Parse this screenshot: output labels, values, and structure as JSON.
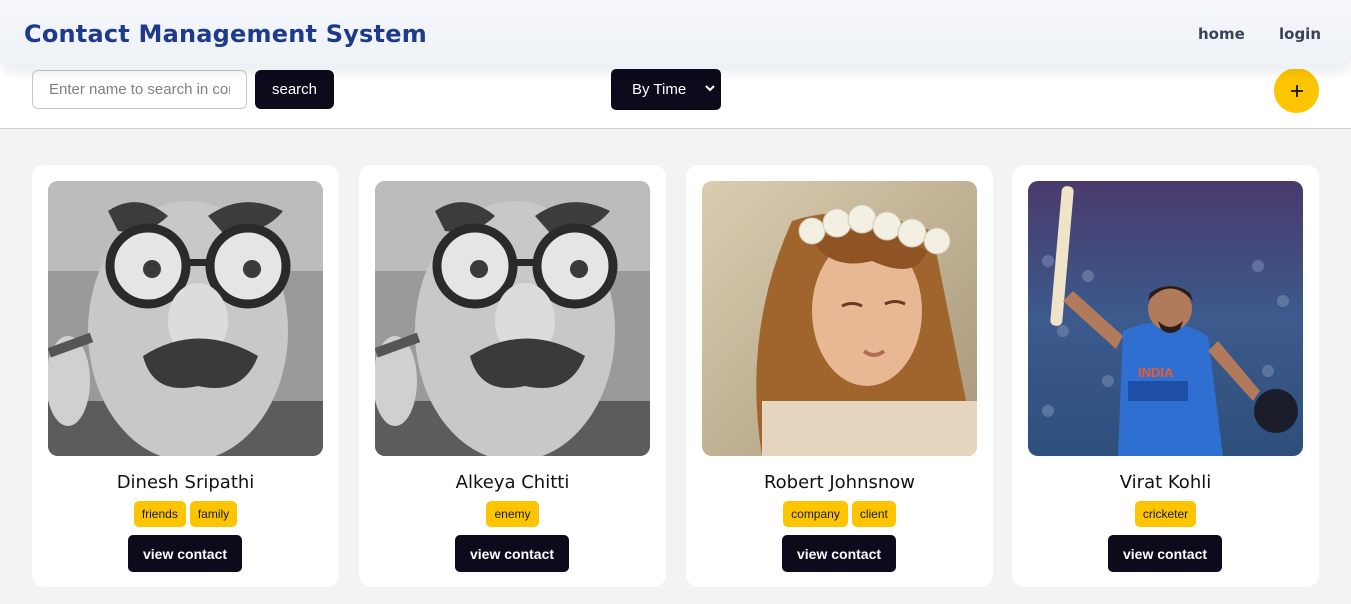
{
  "navbar": {
    "brand": "Contact Management System",
    "links": [
      "home",
      "login"
    ]
  },
  "toolbar": {
    "search_placeholder": "Enter name to search in contacts",
    "search_label": "search",
    "sort_value": "By Time",
    "add_icon": "plus-icon"
  },
  "colors": {
    "brand": "#1e3a8a",
    "accent": "#fcc500",
    "dark_button": "#0d0a1c",
    "page_bg": "#f3f3f3"
  },
  "contacts": [
    {
      "name": "Dinesh Sripathi",
      "tags": [
        "friends",
        "family"
      ],
      "button": "view contact",
      "photo": "bw-man-disguise-glasses"
    },
    {
      "name": "Alkeya Chitti",
      "tags": [
        "enemy"
      ],
      "button": "view contact",
      "photo": "bw-man-disguise-glasses"
    },
    {
      "name": "Robert Johnsnow",
      "tags": [
        "company",
        "client"
      ],
      "button": "view contact",
      "photo": "woman-flower-crown"
    },
    {
      "name": "Virat Kohli",
      "tags": [
        "cricketer"
      ],
      "button": "view contact",
      "photo": "cricketer-raising-bat"
    }
  ]
}
